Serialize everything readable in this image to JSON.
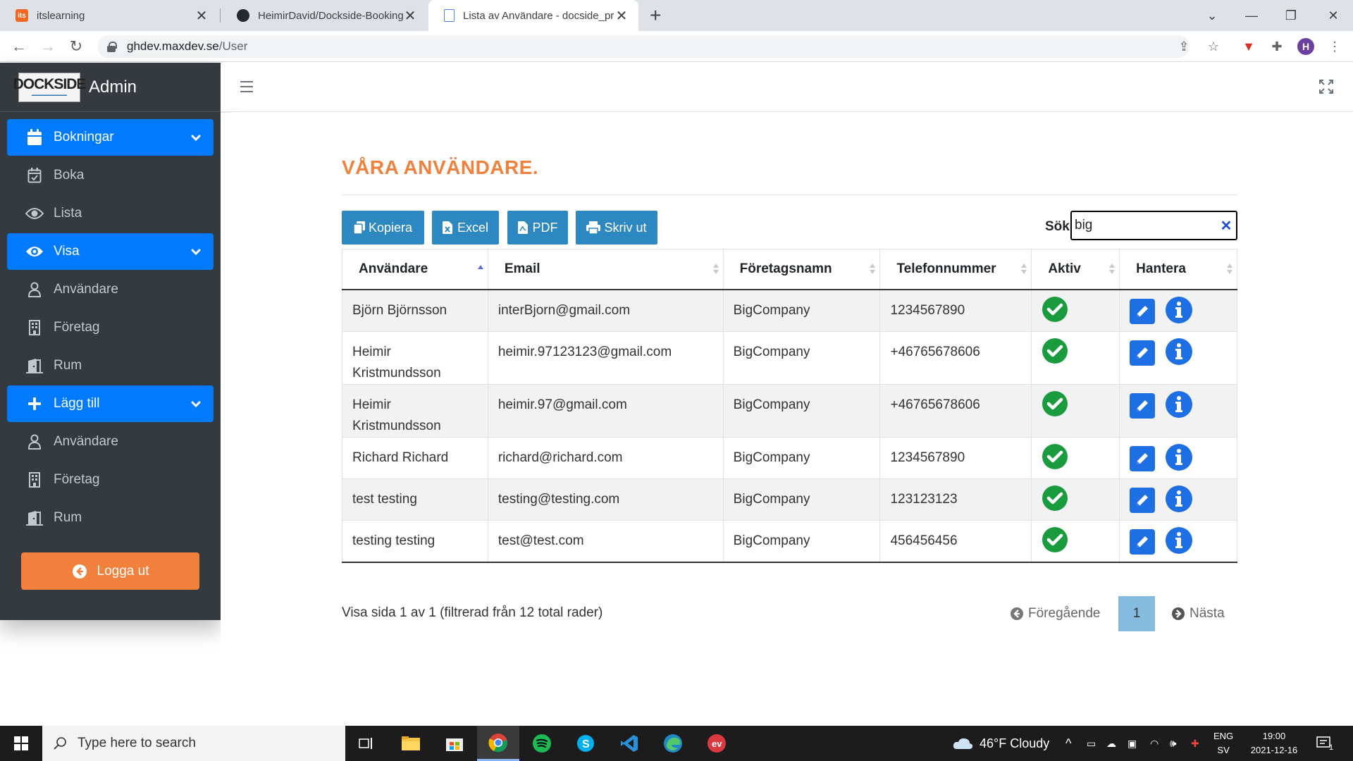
{
  "browser": {
    "tabs": [
      {
        "title": "itslearning",
        "favicon": "its"
      },
      {
        "title": "HeimirDavid/Dockside-Booking-f",
        "favicon": "github-icon"
      },
      {
        "title": "Lista av Användare - docside_pro",
        "favicon": "document-icon"
      }
    ],
    "url_host": "ghdev.maxdev.se",
    "url_path": "/User",
    "profile_initial": "H"
  },
  "sidebar": {
    "brand_logo": "DOCKSIDE",
    "brand_title": "Admin",
    "items": [
      {
        "label": "Bokningar",
        "icon": "calendar-icon",
        "active": true,
        "dropdown": true
      },
      {
        "label": "Boka",
        "icon": "calendar-check-icon"
      },
      {
        "label": "Lista",
        "icon": "eye-icon"
      },
      {
        "label": "Visa",
        "icon": "eye-icon",
        "active": true,
        "dropdown": true
      },
      {
        "label": "Användare",
        "icon": "user-icon"
      },
      {
        "label": "Företag",
        "icon": "building-icon"
      },
      {
        "label": "Rum",
        "icon": "door-icon"
      },
      {
        "label": "Lägg till",
        "icon": "plus-icon",
        "active": true,
        "dropdown": true
      },
      {
        "label": "Användare",
        "icon": "user-icon"
      },
      {
        "label": "Företag",
        "icon": "building-icon"
      },
      {
        "label": "Rum",
        "icon": "door-icon"
      }
    ],
    "logout_label": "Logga ut"
  },
  "main": {
    "title": "VÅRA ANVÄNDARE.",
    "buttons": {
      "copy": "Kopiera",
      "excel": "Excel",
      "pdf": "PDF",
      "print": "Skriv ut"
    },
    "search_label": "Sök",
    "search_value": "big",
    "columns": [
      "Användare",
      "Email",
      "Företagsnamn",
      "Telefonnummer",
      "Aktiv",
      "Hantera"
    ],
    "rows": [
      {
        "user": "Björn Björnsson",
        "email": "interBjorn@gmail.com",
        "company": "BigCompany",
        "phone": "1234567890",
        "active": true
      },
      {
        "user": "Heimir Kristmundsson",
        "email": "heimir.97123123@gmail.com",
        "company": "BigCompany",
        "phone": "+46765678606",
        "active": true
      },
      {
        "user": "Heimir Kristmundsson",
        "email": "heimir.97@gmail.com",
        "company": "BigCompany",
        "phone": "+46765678606",
        "active": true
      },
      {
        "user": "Richard Richard",
        "email": "richard@richard.com",
        "company": "BigCompany",
        "phone": "1234567890",
        "active": true
      },
      {
        "user": "test testing",
        "email": "testing@testing.com",
        "company": "BigCompany",
        "phone": "123123123",
        "active": true
      },
      {
        "user": "testing testing",
        "email": "test@test.com",
        "company": "BigCompany",
        "phone": "456456456",
        "active": true
      }
    ],
    "info": "Visa sida 1 av 1 (filtrerad från 12 total rader)",
    "pager": {
      "prev": "Föregående",
      "current": "1",
      "next": "Nästa"
    }
  },
  "taskbar": {
    "search_placeholder": "Type here to search",
    "weather": "46°F  Cloudy",
    "lang": "ENG",
    "layout": "SV",
    "time": "19:00",
    "date": "2021-12-16",
    "notifications": "1"
  },
  "colors": {
    "primary": "#007bff",
    "sidebar_bg": "#343a40",
    "accent_orange": "#f0803c",
    "button_blue": "#2d88c2",
    "success_green": "#1a9c3e"
  }
}
